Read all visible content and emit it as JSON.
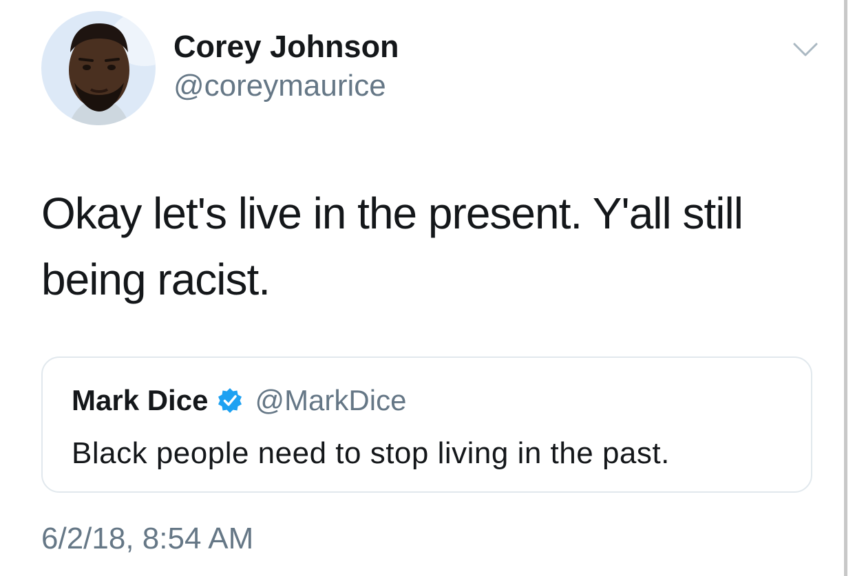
{
  "tweet": {
    "author": {
      "display_name": "Corey Johnson",
      "handle": "@coreymaurice",
      "avatar_icon": "profile-photo"
    },
    "text": "Okay let's live in the present. Y'all still being racist.",
    "timestamp": "6/2/18, 8:54 AM",
    "menu_icon": "chevron-down-icon"
  },
  "quoted_tweet": {
    "display_name": "Mark Dice",
    "verified": true,
    "verified_icon": "verified-badge-icon",
    "handle": "@MarkDice",
    "text": "Black people need to stop living in the past."
  },
  "colors": {
    "primary_text": "#14171a",
    "secondary_text": "#657786",
    "border": "#e1e8ed",
    "verified_blue": "#1da1f2"
  }
}
